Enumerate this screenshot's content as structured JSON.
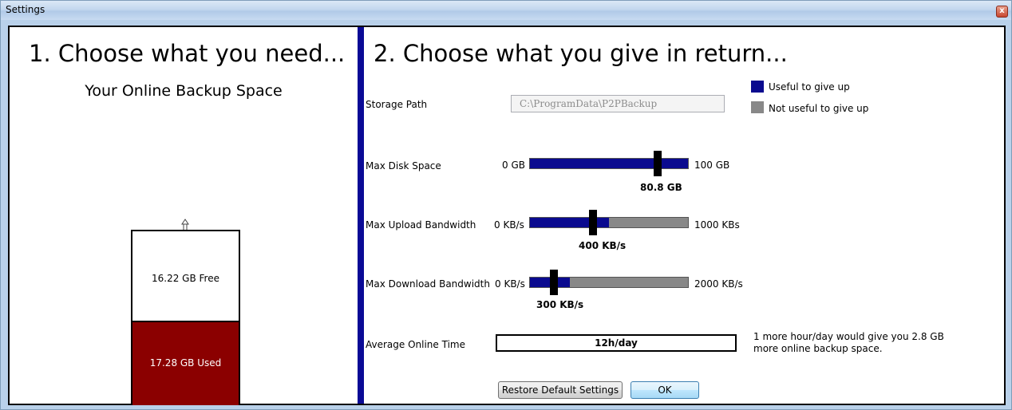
{
  "window": {
    "title": "Settings",
    "close_glyph": "x"
  },
  "left": {
    "heading": "1.  Choose what you need...",
    "subtitle": "Your Online Backup Space",
    "free_label": "16.22 GB Free",
    "used_label": "17.28 GB Used",
    "free_gb": 16.22,
    "used_gb": 17.28,
    "used_color": "#8b0000"
  },
  "right": {
    "heading": "2.  Choose what you give in return...",
    "storage_path": {
      "label": "Storage Path",
      "value": "C:\\ProgramData\\P2PBackup"
    },
    "legend": [
      {
        "label": "Useful to give up",
        "color": "#0a0a8f"
      },
      {
        "label": "Not useful to give up",
        "color": "#888888"
      }
    ],
    "sliders": [
      {
        "label": "Max Disk Space",
        "min_label": "0 GB",
        "max_label": "100 GB",
        "value_label": "80.8 GB",
        "min": 0,
        "max": 100,
        "value": 80.8,
        "useful_fraction": 1.0
      },
      {
        "label": "Max Upload Bandwidth",
        "min_label": "0 KB/s",
        "max_label": "1000 KBs",
        "value_label": "400 KB/s",
        "min": 0,
        "max": 1000,
        "value": 400,
        "useful_fraction": 0.5
      },
      {
        "label": "Max Download Bandwidth",
        "min_label": "0 KB/s",
        "max_label": "2000 KB/s",
        "value_label": "300 KB/s",
        "min": 0,
        "max": 2000,
        "value": 300,
        "useful_fraction": 0.25
      }
    ],
    "online_time": {
      "label": "Average Online Time",
      "value": "12h/day",
      "note": "1 more hour/day would give you 2.8 GB more online backup space."
    },
    "buttons": {
      "restore": "Restore Default Settings",
      "ok": "OK"
    }
  }
}
